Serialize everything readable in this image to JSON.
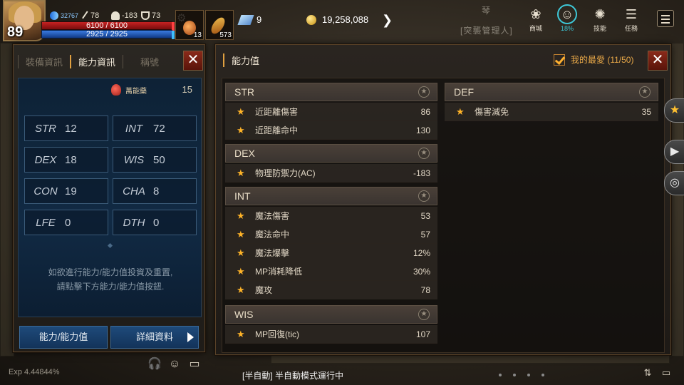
{
  "hud": {
    "level": "89",
    "stat1": "32767",
    "stat2": "78",
    "stat3": "-183",
    "stat4": "73",
    "hp": "6100 / 6100",
    "mp": "2925 / 2925",
    "slot1_count": "13",
    "slot2_count": "573",
    "crystal": "9",
    "gold": "19,258,088",
    "top_tag": "琴",
    "center_tag": "[突襲管理人]",
    "menu": [
      {
        "label": "商城",
        "icon": "shop-bag-icon"
      },
      {
        "label": "18%",
        "icon": "face-percent-icon"
      },
      {
        "label": "技能",
        "icon": "skill-icon"
      },
      {
        "label": "任務",
        "icon": "quest-scroll-icon"
      }
    ]
  },
  "left_panel": {
    "tabs": [
      "裝備資訊",
      "能力資訊",
      "稱號"
    ],
    "potion_label": "萬能藥",
    "potion_count": "15",
    "stats": [
      {
        "k": "STR",
        "v": "12"
      },
      {
        "k": "INT",
        "v": "72"
      },
      {
        "k": "DEX",
        "v": "18"
      },
      {
        "k": "WIS",
        "v": "50"
      },
      {
        "k": "CON",
        "v": "19"
      },
      {
        "k": "CHA",
        "v": "8"
      },
      {
        "k": "LFE",
        "v": "0"
      },
      {
        "k": "DTH",
        "v": "0"
      }
    ],
    "hint_line1": "如欲進行能力/能力值投資及重置,",
    "hint_line2": "請點擊下方能力/能力值按鈕.",
    "btn_ability": "能力/能力值",
    "btn_detail": "詳細資料"
  },
  "right_panel": {
    "title": "能力值",
    "favorites": "我的最愛 (11/50)",
    "groups_left": [
      {
        "name": "STR",
        "rows": [
          {
            "n": "近距離傷害",
            "v": "86"
          },
          {
            "n": "近距離命中",
            "v": "130"
          }
        ]
      },
      {
        "name": "DEX",
        "rows": [
          {
            "n": "物理防禦力(AC)",
            "v": "-183"
          }
        ]
      },
      {
        "name": "INT",
        "rows": [
          {
            "n": "魔法傷害",
            "v": "53"
          },
          {
            "n": "魔法命中",
            "v": "57"
          },
          {
            "n": "魔法爆擊",
            "v": "12%"
          },
          {
            "n": "MP消耗降低",
            "v": "30%"
          },
          {
            "n": "魔攻",
            "v": "78"
          }
        ]
      },
      {
        "name": "WIS",
        "rows": [
          {
            "n": "MP回復(tic)",
            "v": "107"
          }
        ]
      }
    ],
    "groups_right": [
      {
        "name": "DEF",
        "rows": [
          {
            "n": "傷害減免",
            "v": "35"
          }
        ]
      }
    ]
  },
  "bottom": {
    "exp": "Exp  4.44844%",
    "auto": "[半自動] 半自動模式運行中"
  }
}
